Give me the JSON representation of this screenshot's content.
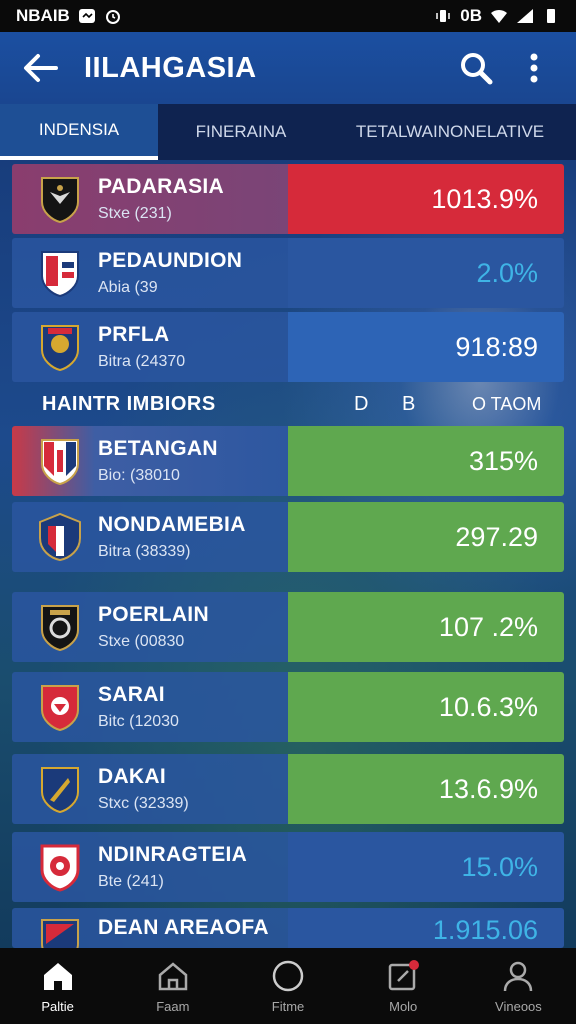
{
  "status_bar": {
    "left_text": "NBAIB",
    "right_text": "0B"
  },
  "app_bar": {
    "title": "IILAHGASIA"
  },
  "tabs": [
    "INDENSIA",
    "FINERAINA",
    "TETALWAINONELATIVE"
  ],
  "section": {
    "label": "HAINTR  IMBIORS",
    "col1": "D",
    "col2": "B",
    "col3": "O TAOM"
  },
  "teams": [
    {
      "name": "PADARASIA",
      "sub": "Stxe (231)",
      "value": "1013.9%",
      "colors": {
        "value_bg": "#d62a3a"
      }
    },
    {
      "name": "PEDAUNDION",
      "sub": "Abia (39",
      "value": "2.0%",
      "colors": {
        "value_text": "#3fb4e6"
      }
    },
    {
      "name": "PRFLA",
      "sub": "Bitra (24370",
      "value": "918:89",
      "colors": {
        "value_bg": "#2d64b6"
      }
    },
    {
      "name": "BETANGAN",
      "sub": "Bio: (38010",
      "value": "315%",
      "colors": {
        "value_bg": "#5fa84f"
      }
    },
    {
      "name": "NONDAMEBIA",
      "sub": "Bitra (38339)",
      "value": "297.29",
      "colors": {
        "value_bg": "#5fa84f"
      }
    },
    {
      "name": "POERLAIN",
      "sub": "Stxe (00830",
      "value": "107 .2%",
      "colors": {
        "value_bg": "#5fa84f"
      }
    },
    {
      "name": "SARAI",
      "sub": "Bitc (12030",
      "value": "10.6.3%",
      "colors": {
        "value_bg": "#5fa84f"
      }
    },
    {
      "name": "DAKAI",
      "sub": "Stxc (32339)",
      "value": "13.6.9%",
      "colors": {
        "value_bg": "#5fa84f"
      }
    },
    {
      "name": "NDINRAGTEIA",
      "sub": "Bte (241)",
      "value": "15.0%",
      "colors": {
        "value_text": "#3fb4e6"
      }
    },
    {
      "name": "DEAN AREAOFA",
      "sub": "",
      "value": "1.915.06",
      "colors": {
        "value_text": "#3fb4e6"
      }
    }
  ],
  "bottom_nav": [
    "Paltie",
    "Faam",
    "Fitme",
    "Molo",
    "Vineoos"
  ]
}
